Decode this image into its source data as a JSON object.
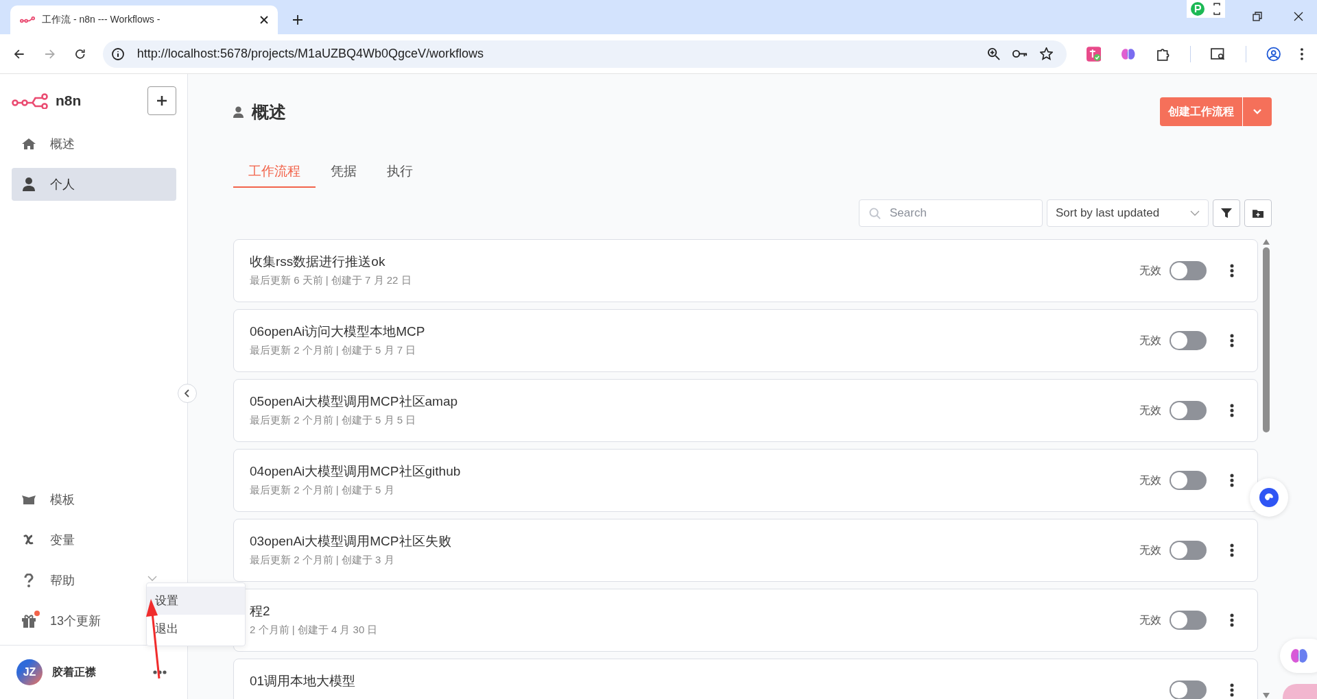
{
  "browser": {
    "tab_title": "工作流 - n8n --- Workflows - ",
    "url": "http://localhost:5678/projects/M1aUZBQ4Wb0QgceV/workflows"
  },
  "sidebar": {
    "logo": "n8n",
    "top_items": [
      {
        "label": "概述",
        "selected": false
      },
      {
        "label": "个人",
        "selected": true
      }
    ],
    "bottom_items": [
      {
        "label": "模板",
        "badge": false
      },
      {
        "label": "变量",
        "badge": false
      },
      {
        "label": "帮助",
        "badge": false
      },
      {
        "label": "13个更新",
        "badge": true
      }
    ],
    "user": {
      "initials": "JZ",
      "name": "胶着正襟"
    }
  },
  "menu": {
    "items": [
      {
        "label": "设置",
        "selected": true
      },
      {
        "label": "退出",
        "selected": false
      }
    ]
  },
  "header": {
    "title": "概述",
    "create_button": "创建工作流程"
  },
  "tabs": [
    {
      "label": "工作流程",
      "selected": true
    },
    {
      "label": "凭据",
      "selected": false
    },
    {
      "label": "执行",
      "selected": false
    }
  ],
  "toolbar": {
    "search_placeholder": "Search",
    "sort": "Sort by last updated"
  },
  "workflows": [
    {
      "name": "收集rss数据进行推送ok",
      "meta": "最后更新 6 天前 | 创建于 7 月 22 日",
      "status": "无效",
      "active": false
    },
    {
      "name": "06openAi访问大模型本地MCP",
      "meta": "最后更新 2 个月前 | 创建于 5 月 7 日",
      "status": "无效",
      "active": false
    },
    {
      "name": "05openAi大模型调用MCP社区amap",
      "meta": "最后更新 2 个月前 | 创建于 5 月 5 日",
      "status": "无效",
      "active": false
    },
    {
      "name": "04openAi大模型调用MCP社区github",
      "meta": "最后更新 2 个月前 | 创建于 5 月",
      "status": "无效",
      "active": false
    },
    {
      "name": "03openAi大模型调用MCP社区失败",
      "meta": "最后更新 2 个月前 | 创建于 3 月",
      "status": "无效",
      "active": false
    },
    {
      "name": "程2",
      "meta": "2 个月前 | 创建于 4 月 30 日",
      "status": "无效",
      "active": false
    },
    {
      "name": "01调用本地大模型",
      "active": false
    }
  ]
}
